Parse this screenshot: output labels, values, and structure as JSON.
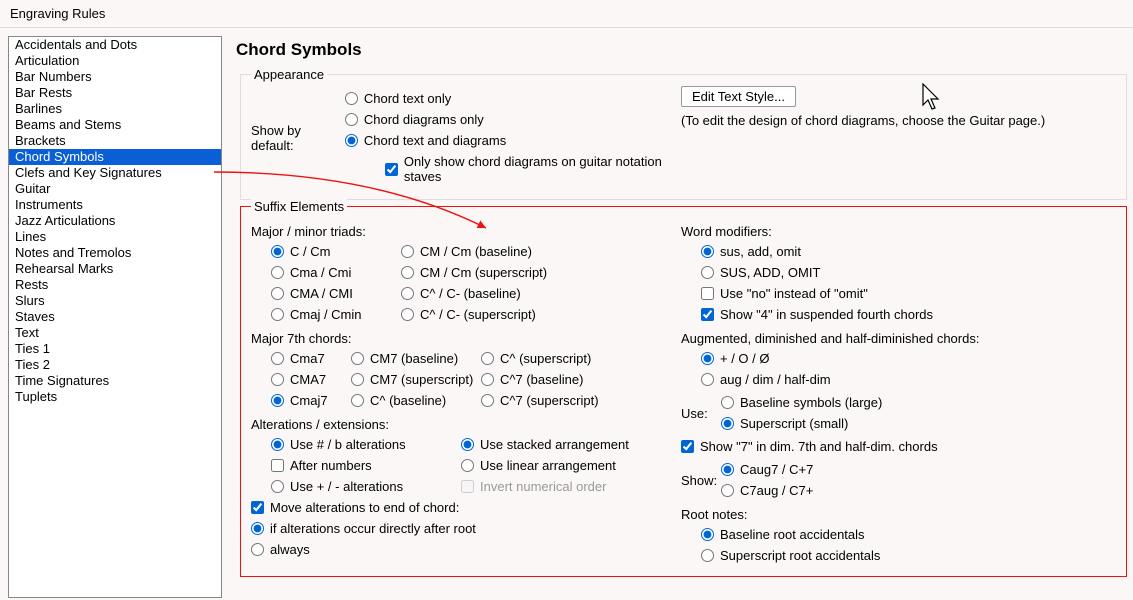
{
  "window_title": "Engraving Rules",
  "sidebar": {
    "items": [
      "Accidentals and Dots",
      "Articulation",
      "Bar Numbers",
      "Bar Rests",
      "Barlines",
      "Beams and Stems",
      "Brackets",
      "Chord Symbols",
      "Clefs and Key Signatures",
      "Guitar",
      "Instruments",
      "Jazz Articulations",
      "Lines",
      "Notes and Tremolos",
      "Rehearsal Marks",
      "Rests",
      "Slurs",
      "Staves",
      "Text",
      "Ties 1",
      "Ties 2",
      "Time Signatures",
      "Tuplets"
    ],
    "selected_index": 7
  },
  "page": {
    "title": "Chord Symbols",
    "appearance": {
      "legend": "Appearance",
      "show_by_default": "Show by default:",
      "options": [
        "Chord text only",
        "Chord diagrams only",
        "Chord text and diagrams"
      ],
      "selected": 2,
      "only_guitar_staves": "Only show chord diagrams on guitar notation staves",
      "only_guitar_staves_checked": true,
      "edit_button": "Edit Text Style...",
      "note": "(To edit the design of chord diagrams, choose the Guitar page.)"
    },
    "suffix": {
      "legend": "Suffix Elements",
      "major_minor_triads": {
        "label": "Major / minor triads:",
        "left": [
          "C / Cm",
          "Cma / Cmi",
          "CMA / CMI",
          "Cmaj / Cmin"
        ],
        "right": [
          "CM / Cm (baseline)",
          "CM / Cm (superscript)",
          "C^ / C- (baseline)",
          "C^ / C- (superscript)"
        ],
        "selected": 0
      },
      "major7": {
        "label": "Major 7th chords:",
        "col1": [
          "Cma7",
          "CMA7",
          "Cmaj7"
        ],
        "col2": [
          "CM7 (baseline)",
          "CM7 (superscript)",
          "C^ (baseline)"
        ],
        "col3": [
          "C^ (superscript)",
          "C^7 (baseline)",
          "C^7 (superscript)"
        ],
        "selected": 2
      },
      "alterations": {
        "label": "Alterations / extensions:",
        "use_hash_b": "Use # / b alterations",
        "after_numbers": "After numbers",
        "use_plus_minus": "Use + / - alterations",
        "alt_selected": 0,
        "after_numbers_checked": false,
        "stacked": "Use stacked arrangement",
        "linear": "Use linear arrangement",
        "invert": "Invert numerical order",
        "arr_selected": 0,
        "invert_enabled": false,
        "move_end": "Move alterations to end of chord:",
        "move_end_checked": true,
        "if_after_root": "if alterations occur directly after root",
        "always": "always",
        "when_selected": 0
      },
      "word_modifiers": {
        "label": "Word modifiers:",
        "lower": "sus, add, omit",
        "upper": "SUS, ADD, OMIT",
        "selected": 0,
        "use_no": "Use \"no\" instead of \"omit\"",
        "use_no_checked": false,
        "show4": "Show \"4\" in suspended fourth chords",
        "show4_checked": true
      },
      "aug_dim": {
        "label": "Augmented, diminished and half-diminished chords:",
        "sym": "+ / O / Ø",
        "words": "aug / dim / half-dim",
        "selected": 0,
        "use_label": "Use:",
        "baseline_large": "Baseline symbols (large)",
        "super_small": "Superscript (small)",
        "size_selected": 1,
        "show7": "Show \"7\" in dim. 7th and half-dim. chords",
        "show7_checked": true,
        "show_label": "Show:",
        "caug7": "Caug7 / C+7",
        "c7aug": "C7aug / C7+",
        "order_selected": 0
      },
      "root": {
        "label": "Root notes:",
        "baseline": "Baseline root accidentals",
        "superscript": "Superscript root accidentals",
        "selected": 0
      }
    }
  }
}
